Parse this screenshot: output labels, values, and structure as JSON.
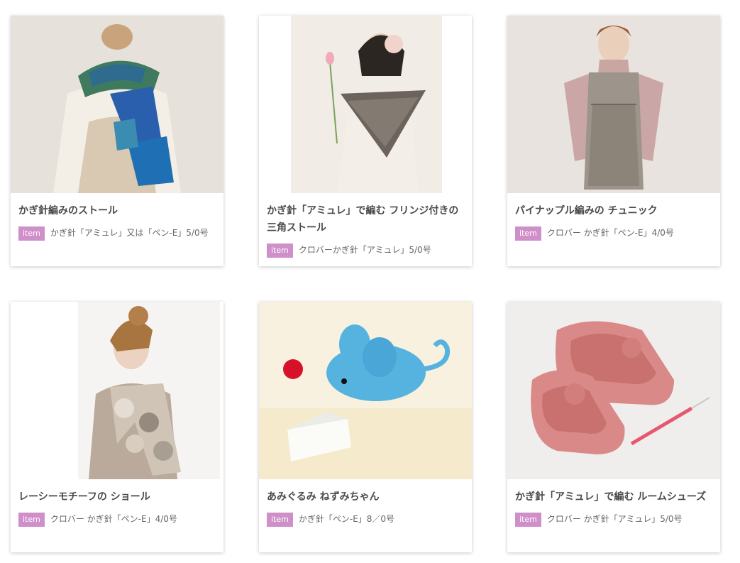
{
  "badge_label": "item",
  "colors": {
    "badge": "#cf8fc9",
    "title": "#4a4a4a",
    "text": "#666666"
  },
  "cards": [
    {
      "title": "かぎ針編みのストール",
      "tool": "かぎ針「アミュレ」又は「ペン-E」5/0号",
      "image": "crochet-stole-photo"
    },
    {
      "title": "かぎ針「アミュレ」で編む フリンジ付きの三角ストール",
      "tool": "クロバーかぎ針「アミュレ」5/0号",
      "image": "triangle-fringe-stole-photo"
    },
    {
      "title": "パイナップル編みの チュニック",
      "tool": "クロバー かぎ針「ペン-E」4/0号",
      "image": "pineapple-tunic-photo"
    },
    {
      "title": "レーシーモチーフの ショール",
      "tool": "クロバー かぎ針「ペン-E」4/0号",
      "image": "lacy-motif-shawl-photo"
    },
    {
      "title": "あみぐるみ ねずみちゃん",
      "tool": "かぎ針「ペン-E」8／0号",
      "image": "amigurumi-mouse-photo"
    },
    {
      "title": "かぎ針「アミュレ」で編む ルームシューズ",
      "tool": "クロバー かぎ針「アミュレ」5/0号",
      "image": "room-shoes-photo"
    }
  ]
}
